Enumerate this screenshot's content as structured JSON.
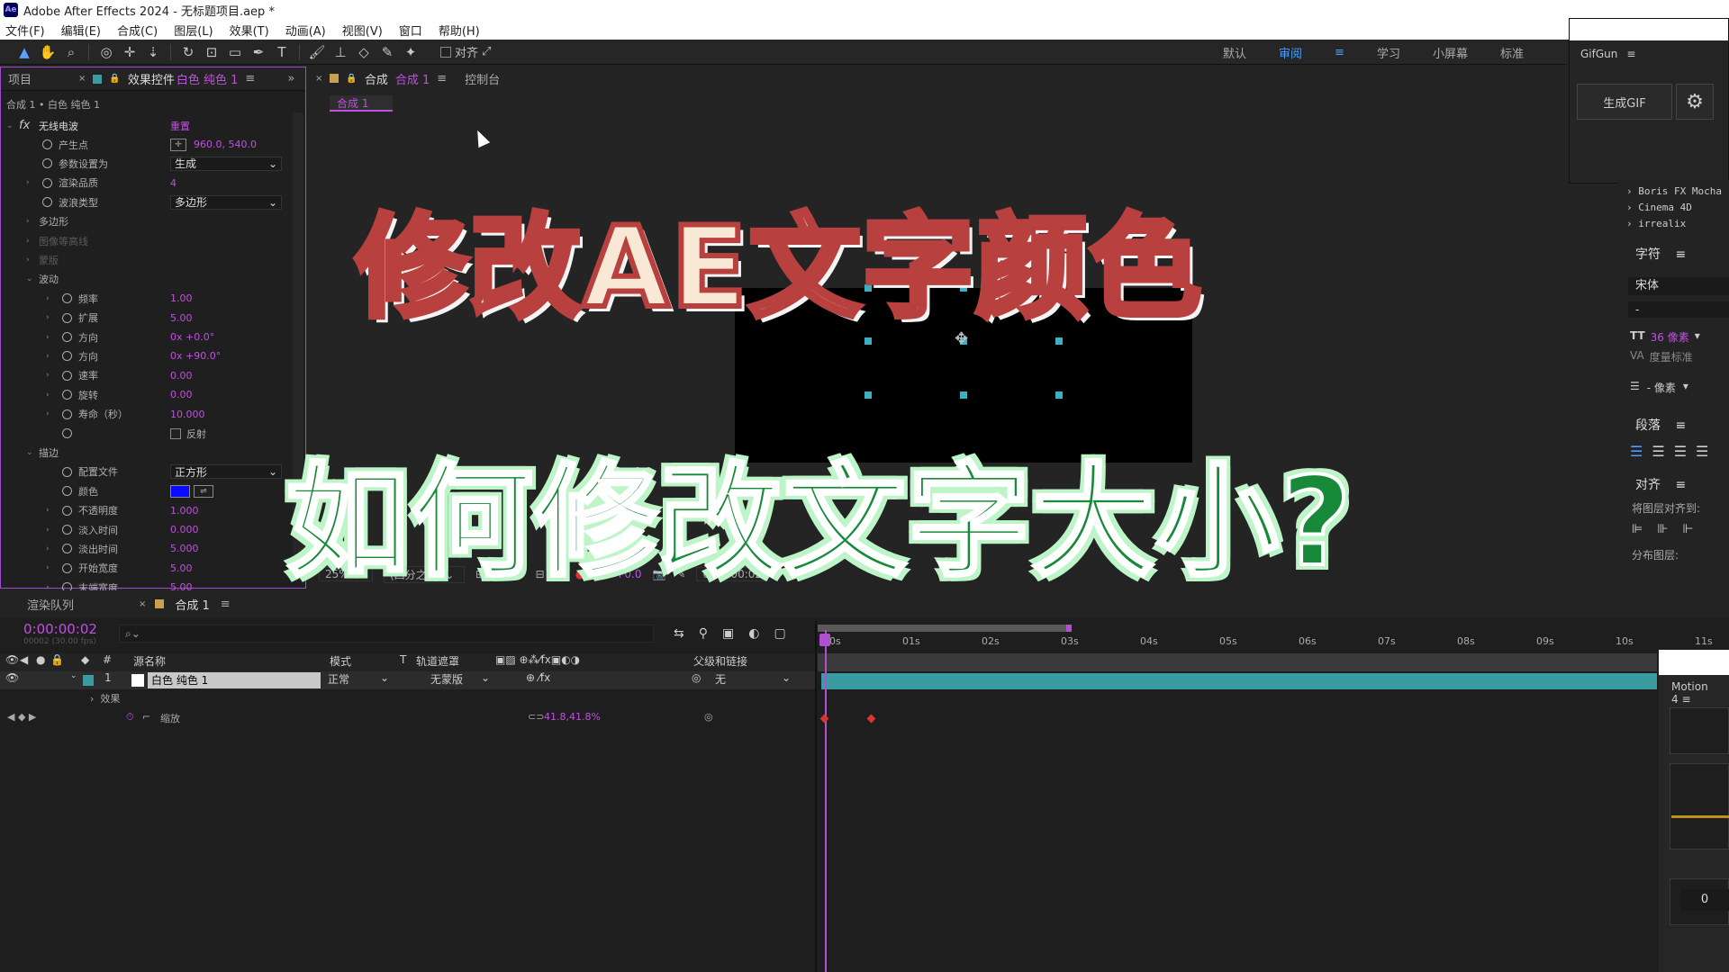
{
  "window": {
    "title": "Adobe After Effects 2024 - 无标题项目.aep *",
    "app_badge": "Ae"
  },
  "menu": [
    "文件(F)",
    "编辑(E)",
    "合成(C)",
    "图层(L)",
    "效果(T)",
    "动画(A)",
    "视图(V)",
    "窗口",
    "帮助(H)"
  ],
  "toolbar": {
    "snap_label": "对齐"
  },
  "workspaces": [
    "默认",
    "审阅",
    "学习",
    "小屏幕",
    "标准"
  ],
  "effects_panel": {
    "tab_project": "项目",
    "tab_effects": "效果控件",
    "tab_layer": "白色 纯色 1",
    "breadcrumb": "合成 1 • 白色 纯色 1",
    "effect_name": "无线电波",
    "reset_label": "重置",
    "rows": [
      {
        "label": "产生点",
        "value": "960.0, 540.0"
      },
      {
        "label": "参数设置为",
        "value": "生成"
      },
      {
        "label": "渲染品质",
        "value": "4"
      },
      {
        "label": "波浪类型",
        "value": "多边形"
      },
      {
        "label": "多边形",
        "value": ""
      },
      {
        "label": "图像等高线",
        "value": ""
      },
      {
        "label": "蒙版",
        "value": ""
      },
      {
        "label": "波动",
        "value": ""
      },
      {
        "label": "频率",
        "value": "1.00"
      },
      {
        "label": "扩展",
        "value": "5.00"
      },
      {
        "label": "方向",
        "value": "0x +0.0°"
      },
      {
        "label": "方向",
        "value": "0x +90.0°"
      },
      {
        "label": "速率",
        "value": "0.00"
      },
      {
        "label": "旋转",
        "value": "0.00"
      },
      {
        "label": "寿命（秒）",
        "value": "10.000"
      },
      {
        "label": "",
        "value": "反射"
      },
      {
        "label": "描边",
        "value": ""
      },
      {
        "label": "配置文件",
        "value": "正方形"
      },
      {
        "label": "颜色",
        "value": ""
      },
      {
        "label": "不透明度",
        "value": "1.000"
      },
      {
        "label": "淡入时间",
        "value": "0.000"
      },
      {
        "label": "淡出时间",
        "value": "5.000"
      },
      {
        "label": "开始宽度",
        "value": "5.00"
      },
      {
        "label": "末端宽度",
        "value": "5.00"
      }
    ]
  },
  "comp_panel": {
    "tab_comp": "合成",
    "tab_comp_name": "合成 1",
    "tab_console": "控制台",
    "sub_tab": "合成 1",
    "zoom": "25%",
    "resolution": "(四分之一)",
    "exposure": "+0.0",
    "timecode": "0:00:00:02"
  },
  "overlay": {
    "headline_1": "修改AE文字颜色",
    "headline_2": "如何修改文字大小?"
  },
  "gifgun": {
    "title": "GifGun",
    "button": "生成GIF"
  },
  "effects_list": [
    "Boris FX Mocha",
    "Cinema 4D",
    "irrealix"
  ],
  "char_panel": {
    "title": "字符",
    "font": "宋体",
    "style": "-",
    "size": "36 像素",
    "tracking": "度量标准",
    "leading": "- 像素"
  },
  "para_panel": {
    "title": "段落"
  },
  "align_panel": {
    "title": "对齐",
    "align_to": "将图层对齐到:",
    "distribute": "分布图层:"
  },
  "timeline": {
    "tab_render": "渲染队列",
    "tab_comp": "合成 1",
    "timecode": "0:00:00:02",
    "timecode_sub": "00002 (30.00 fps)",
    "columns": {
      "source": "源名称",
      "mode": "模式",
      "t": "T",
      "track": "轨道遮罩",
      "parent": "父级和链接"
    },
    "layer": {
      "num": "1",
      "name": "白色 纯色 1",
      "mode": "正常",
      "track": "无蒙版",
      "parent": "无"
    },
    "sub_effects": "效果",
    "sub_scale": "缩放",
    "scale_value": "41.8,41.8%",
    "ruler": [
      "00s",
      "01s",
      "02s",
      "03s",
      "04s",
      "05s",
      "06s",
      "07s",
      "08s",
      "09s",
      "10s",
      "11s"
    ],
    "motion_panel": "Motion 4",
    "motion_value": "0"
  },
  "colors": {
    "accent": "#4a9cff",
    "effect_border": "#a24ad0",
    "value_purple": "#c050e0",
    "layer_bar": "#3a9ba0",
    "headline1_stroke": "#b8403e",
    "headline2_fill": "#178a3a"
  }
}
